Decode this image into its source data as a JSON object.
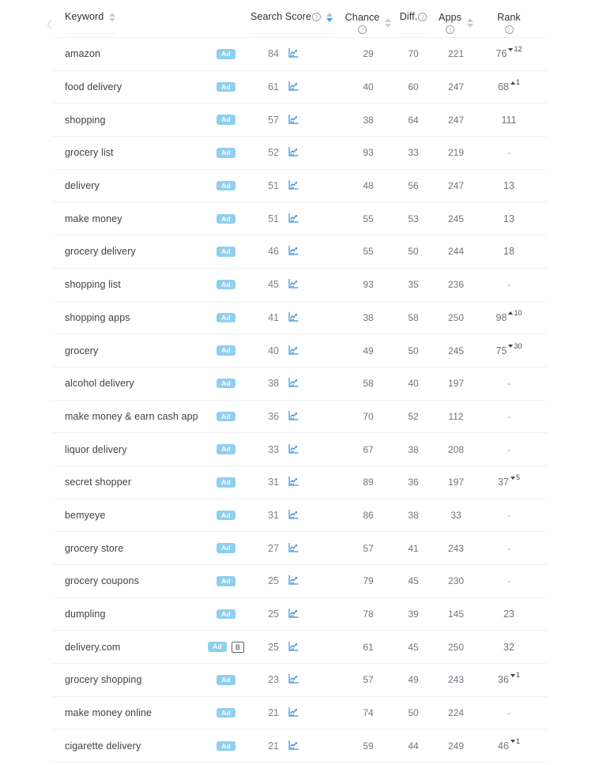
{
  "table": {
    "columns": [
      {
        "key": "keyword",
        "label": "Keyword",
        "help": false,
        "sortable": true,
        "sort_active": false
      },
      {
        "key": "ad",
        "label": "",
        "help": false,
        "sortable": false,
        "sort_active": false
      },
      {
        "key": "score",
        "label": "Search Score",
        "help": true,
        "sortable": true,
        "sort_active": true,
        "sort_dir": "desc"
      },
      {
        "key": "chance",
        "label": "Chance",
        "help": true,
        "sortable": true,
        "sort_active": false
      },
      {
        "key": "diff",
        "label": "Diff.",
        "help": true,
        "sortable": false,
        "sort_active": false
      },
      {
        "key": "apps",
        "label": "Apps",
        "help": true,
        "sortable": true,
        "sort_active": false
      },
      {
        "key": "rank",
        "label": "Rank",
        "help": true,
        "sortable": false,
        "sort_active": false
      }
    ],
    "help_glyph": "?",
    "ad_badge_label": "Ad",
    "b_badge_label": "B",
    "chart_icon_name": "trend-chart-icon",
    "no_value": "-",
    "rows": [
      {
        "keyword": "amazon",
        "ad": true,
        "b": false,
        "score": "84",
        "chance": "29",
        "diff": "70",
        "apps": "221",
        "rank": "76",
        "delta": "12",
        "delta_dir": "down"
      },
      {
        "keyword": "food delivery",
        "ad": true,
        "b": false,
        "score": "61",
        "chance": "40",
        "diff": "60",
        "apps": "247",
        "rank": "68",
        "delta": "1",
        "delta_dir": "up"
      },
      {
        "keyword": "shopping",
        "ad": true,
        "b": false,
        "score": "57",
        "chance": "38",
        "diff": "64",
        "apps": "247",
        "rank": "111",
        "delta": "",
        "delta_dir": "none"
      },
      {
        "keyword": "grocery list",
        "ad": true,
        "b": false,
        "score": "52",
        "chance": "93",
        "diff": "33",
        "apps": "219",
        "rank": "-",
        "delta": "",
        "delta_dir": "none"
      },
      {
        "keyword": "delivery",
        "ad": true,
        "b": false,
        "score": "51",
        "chance": "48",
        "diff": "56",
        "apps": "247",
        "rank": "13",
        "delta": "",
        "delta_dir": "none"
      },
      {
        "keyword": "make money",
        "ad": true,
        "b": false,
        "score": "51",
        "chance": "55",
        "diff": "53",
        "apps": "245",
        "rank": "13",
        "delta": "",
        "delta_dir": "none"
      },
      {
        "keyword": "grocery delivery",
        "ad": true,
        "b": false,
        "score": "46",
        "chance": "55",
        "diff": "50",
        "apps": "244",
        "rank": "18",
        "delta": "",
        "delta_dir": "none"
      },
      {
        "keyword": "shopping list",
        "ad": true,
        "b": false,
        "score": "45",
        "chance": "93",
        "diff": "35",
        "apps": "236",
        "rank": "-",
        "delta": "",
        "delta_dir": "none"
      },
      {
        "keyword": "shopping apps",
        "ad": true,
        "b": false,
        "score": "41",
        "chance": "38",
        "diff": "58",
        "apps": "250",
        "rank": "98",
        "delta": "10",
        "delta_dir": "up"
      },
      {
        "keyword": "grocery",
        "ad": true,
        "b": false,
        "score": "40",
        "chance": "49",
        "diff": "50",
        "apps": "245",
        "rank": "75",
        "delta": "30",
        "delta_dir": "down"
      },
      {
        "keyword": "alcohol delivery",
        "ad": true,
        "b": false,
        "score": "38",
        "chance": "58",
        "diff": "40",
        "apps": "197",
        "rank": "-",
        "delta": "",
        "delta_dir": "none"
      },
      {
        "keyword": "make money & earn cash app",
        "ad": true,
        "b": false,
        "score": "36",
        "chance": "70",
        "diff": "52",
        "apps": "112",
        "rank": "-",
        "delta": "",
        "delta_dir": "none"
      },
      {
        "keyword": "liquor delivery",
        "ad": true,
        "b": false,
        "score": "33",
        "chance": "67",
        "diff": "38",
        "apps": "208",
        "rank": "-",
        "delta": "",
        "delta_dir": "none"
      },
      {
        "keyword": "secret shopper",
        "ad": true,
        "b": false,
        "score": "31",
        "chance": "89",
        "diff": "36",
        "apps": "197",
        "rank": "37",
        "delta": "5",
        "delta_dir": "down"
      },
      {
        "keyword": "bemyeye",
        "ad": true,
        "b": false,
        "score": "31",
        "chance": "86",
        "diff": "38",
        "apps": "33",
        "rank": "-",
        "delta": "",
        "delta_dir": "none"
      },
      {
        "keyword": "grocery store",
        "ad": true,
        "b": false,
        "score": "27",
        "chance": "57",
        "diff": "41",
        "apps": "243",
        "rank": "-",
        "delta": "",
        "delta_dir": "none"
      },
      {
        "keyword": "grocery coupons",
        "ad": true,
        "b": false,
        "score": "25",
        "chance": "79",
        "diff": "45",
        "apps": "230",
        "rank": "-",
        "delta": "",
        "delta_dir": "none"
      },
      {
        "keyword": "dumpling",
        "ad": true,
        "b": false,
        "score": "25",
        "chance": "78",
        "diff": "39",
        "apps": "145",
        "rank": "23",
        "delta": "",
        "delta_dir": "none"
      },
      {
        "keyword": "delivery.com",
        "ad": true,
        "b": true,
        "score": "25",
        "chance": "61",
        "diff": "45",
        "apps": "250",
        "rank": "32",
        "delta": "",
        "delta_dir": "none"
      },
      {
        "keyword": "grocery shopping",
        "ad": true,
        "b": false,
        "score": "23",
        "chance": "57",
        "diff": "49",
        "apps": "243",
        "rank": "36",
        "delta": "1",
        "delta_dir": "down"
      },
      {
        "keyword": "make money online",
        "ad": true,
        "b": false,
        "score": "21",
        "chance": "74",
        "diff": "50",
        "apps": "224",
        "rank": "-",
        "delta": "",
        "delta_dir": "none"
      },
      {
        "keyword": "cigarette delivery",
        "ad": true,
        "b": false,
        "score": "21",
        "chance": "59",
        "diff": "44",
        "apps": "249",
        "rank": "46",
        "delta": "1",
        "delta_dir": "down"
      }
    ]
  },
  "colors": {
    "ad_badge": "#8fcff0",
    "chart_icon": "#3d8fd1",
    "sort_active": "#4a9fe0",
    "text": "#3c4148",
    "muted": "#6e747c",
    "divider": "#f1f2f4"
  }
}
